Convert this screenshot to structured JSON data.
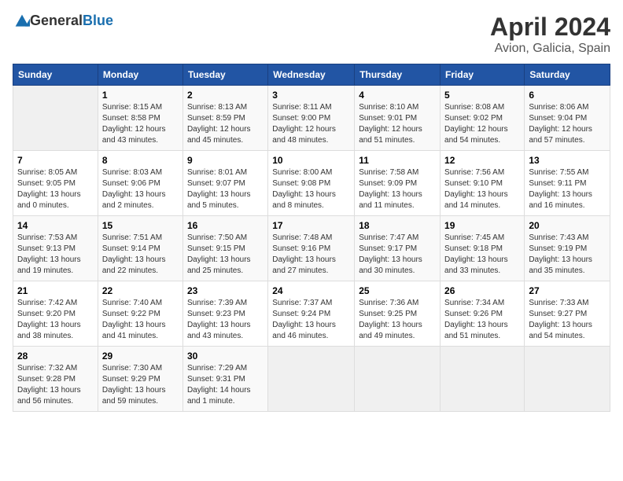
{
  "header": {
    "logo_general": "General",
    "logo_blue": "Blue",
    "month_year": "April 2024",
    "location": "Avion, Galicia, Spain"
  },
  "columns": [
    "Sunday",
    "Monday",
    "Tuesday",
    "Wednesday",
    "Thursday",
    "Friday",
    "Saturday"
  ],
  "weeks": [
    [
      {
        "day": "",
        "sunrise": "",
        "sunset": "",
        "daylight": ""
      },
      {
        "day": "1",
        "sunrise": "Sunrise: 8:15 AM",
        "sunset": "Sunset: 8:58 PM",
        "daylight": "Daylight: 12 hours and 43 minutes."
      },
      {
        "day": "2",
        "sunrise": "Sunrise: 8:13 AM",
        "sunset": "Sunset: 8:59 PM",
        "daylight": "Daylight: 12 hours and 45 minutes."
      },
      {
        "day": "3",
        "sunrise": "Sunrise: 8:11 AM",
        "sunset": "Sunset: 9:00 PM",
        "daylight": "Daylight: 12 hours and 48 minutes."
      },
      {
        "day": "4",
        "sunrise": "Sunrise: 8:10 AM",
        "sunset": "Sunset: 9:01 PM",
        "daylight": "Daylight: 12 hours and 51 minutes."
      },
      {
        "day": "5",
        "sunrise": "Sunrise: 8:08 AM",
        "sunset": "Sunset: 9:02 PM",
        "daylight": "Daylight: 12 hours and 54 minutes."
      },
      {
        "day": "6",
        "sunrise": "Sunrise: 8:06 AM",
        "sunset": "Sunset: 9:04 PM",
        "daylight": "Daylight: 12 hours and 57 minutes."
      }
    ],
    [
      {
        "day": "7",
        "sunrise": "Sunrise: 8:05 AM",
        "sunset": "Sunset: 9:05 PM",
        "daylight": "Daylight: 13 hours and 0 minutes."
      },
      {
        "day": "8",
        "sunrise": "Sunrise: 8:03 AM",
        "sunset": "Sunset: 9:06 PM",
        "daylight": "Daylight: 13 hours and 2 minutes."
      },
      {
        "day": "9",
        "sunrise": "Sunrise: 8:01 AM",
        "sunset": "Sunset: 9:07 PM",
        "daylight": "Daylight: 13 hours and 5 minutes."
      },
      {
        "day": "10",
        "sunrise": "Sunrise: 8:00 AM",
        "sunset": "Sunset: 9:08 PM",
        "daylight": "Daylight: 13 hours and 8 minutes."
      },
      {
        "day": "11",
        "sunrise": "Sunrise: 7:58 AM",
        "sunset": "Sunset: 9:09 PM",
        "daylight": "Daylight: 13 hours and 11 minutes."
      },
      {
        "day": "12",
        "sunrise": "Sunrise: 7:56 AM",
        "sunset": "Sunset: 9:10 PM",
        "daylight": "Daylight: 13 hours and 14 minutes."
      },
      {
        "day": "13",
        "sunrise": "Sunrise: 7:55 AM",
        "sunset": "Sunset: 9:11 PM",
        "daylight": "Daylight: 13 hours and 16 minutes."
      }
    ],
    [
      {
        "day": "14",
        "sunrise": "Sunrise: 7:53 AM",
        "sunset": "Sunset: 9:13 PM",
        "daylight": "Daylight: 13 hours and 19 minutes."
      },
      {
        "day": "15",
        "sunrise": "Sunrise: 7:51 AM",
        "sunset": "Sunset: 9:14 PM",
        "daylight": "Daylight: 13 hours and 22 minutes."
      },
      {
        "day": "16",
        "sunrise": "Sunrise: 7:50 AM",
        "sunset": "Sunset: 9:15 PM",
        "daylight": "Daylight: 13 hours and 25 minutes."
      },
      {
        "day": "17",
        "sunrise": "Sunrise: 7:48 AM",
        "sunset": "Sunset: 9:16 PM",
        "daylight": "Daylight: 13 hours and 27 minutes."
      },
      {
        "day": "18",
        "sunrise": "Sunrise: 7:47 AM",
        "sunset": "Sunset: 9:17 PM",
        "daylight": "Daylight: 13 hours and 30 minutes."
      },
      {
        "day": "19",
        "sunrise": "Sunrise: 7:45 AM",
        "sunset": "Sunset: 9:18 PM",
        "daylight": "Daylight: 13 hours and 33 minutes."
      },
      {
        "day": "20",
        "sunrise": "Sunrise: 7:43 AM",
        "sunset": "Sunset: 9:19 PM",
        "daylight": "Daylight: 13 hours and 35 minutes."
      }
    ],
    [
      {
        "day": "21",
        "sunrise": "Sunrise: 7:42 AM",
        "sunset": "Sunset: 9:20 PM",
        "daylight": "Daylight: 13 hours and 38 minutes."
      },
      {
        "day": "22",
        "sunrise": "Sunrise: 7:40 AM",
        "sunset": "Sunset: 9:22 PM",
        "daylight": "Daylight: 13 hours and 41 minutes."
      },
      {
        "day": "23",
        "sunrise": "Sunrise: 7:39 AM",
        "sunset": "Sunset: 9:23 PM",
        "daylight": "Daylight: 13 hours and 43 minutes."
      },
      {
        "day": "24",
        "sunrise": "Sunrise: 7:37 AM",
        "sunset": "Sunset: 9:24 PM",
        "daylight": "Daylight: 13 hours and 46 minutes."
      },
      {
        "day": "25",
        "sunrise": "Sunrise: 7:36 AM",
        "sunset": "Sunset: 9:25 PM",
        "daylight": "Daylight: 13 hours and 49 minutes."
      },
      {
        "day": "26",
        "sunrise": "Sunrise: 7:34 AM",
        "sunset": "Sunset: 9:26 PM",
        "daylight": "Daylight: 13 hours and 51 minutes."
      },
      {
        "day": "27",
        "sunrise": "Sunrise: 7:33 AM",
        "sunset": "Sunset: 9:27 PM",
        "daylight": "Daylight: 13 hours and 54 minutes."
      }
    ],
    [
      {
        "day": "28",
        "sunrise": "Sunrise: 7:32 AM",
        "sunset": "Sunset: 9:28 PM",
        "daylight": "Daylight: 13 hours and 56 minutes."
      },
      {
        "day": "29",
        "sunrise": "Sunrise: 7:30 AM",
        "sunset": "Sunset: 9:29 PM",
        "daylight": "Daylight: 13 hours and 59 minutes."
      },
      {
        "day": "30",
        "sunrise": "Sunrise: 7:29 AM",
        "sunset": "Sunset: 9:31 PM",
        "daylight": "Daylight: 14 hours and 1 minute."
      },
      {
        "day": "",
        "sunrise": "",
        "sunset": "",
        "daylight": ""
      },
      {
        "day": "",
        "sunrise": "",
        "sunset": "",
        "daylight": ""
      },
      {
        "day": "",
        "sunrise": "",
        "sunset": "",
        "daylight": ""
      },
      {
        "day": "",
        "sunrise": "",
        "sunset": "",
        "daylight": ""
      }
    ]
  ]
}
